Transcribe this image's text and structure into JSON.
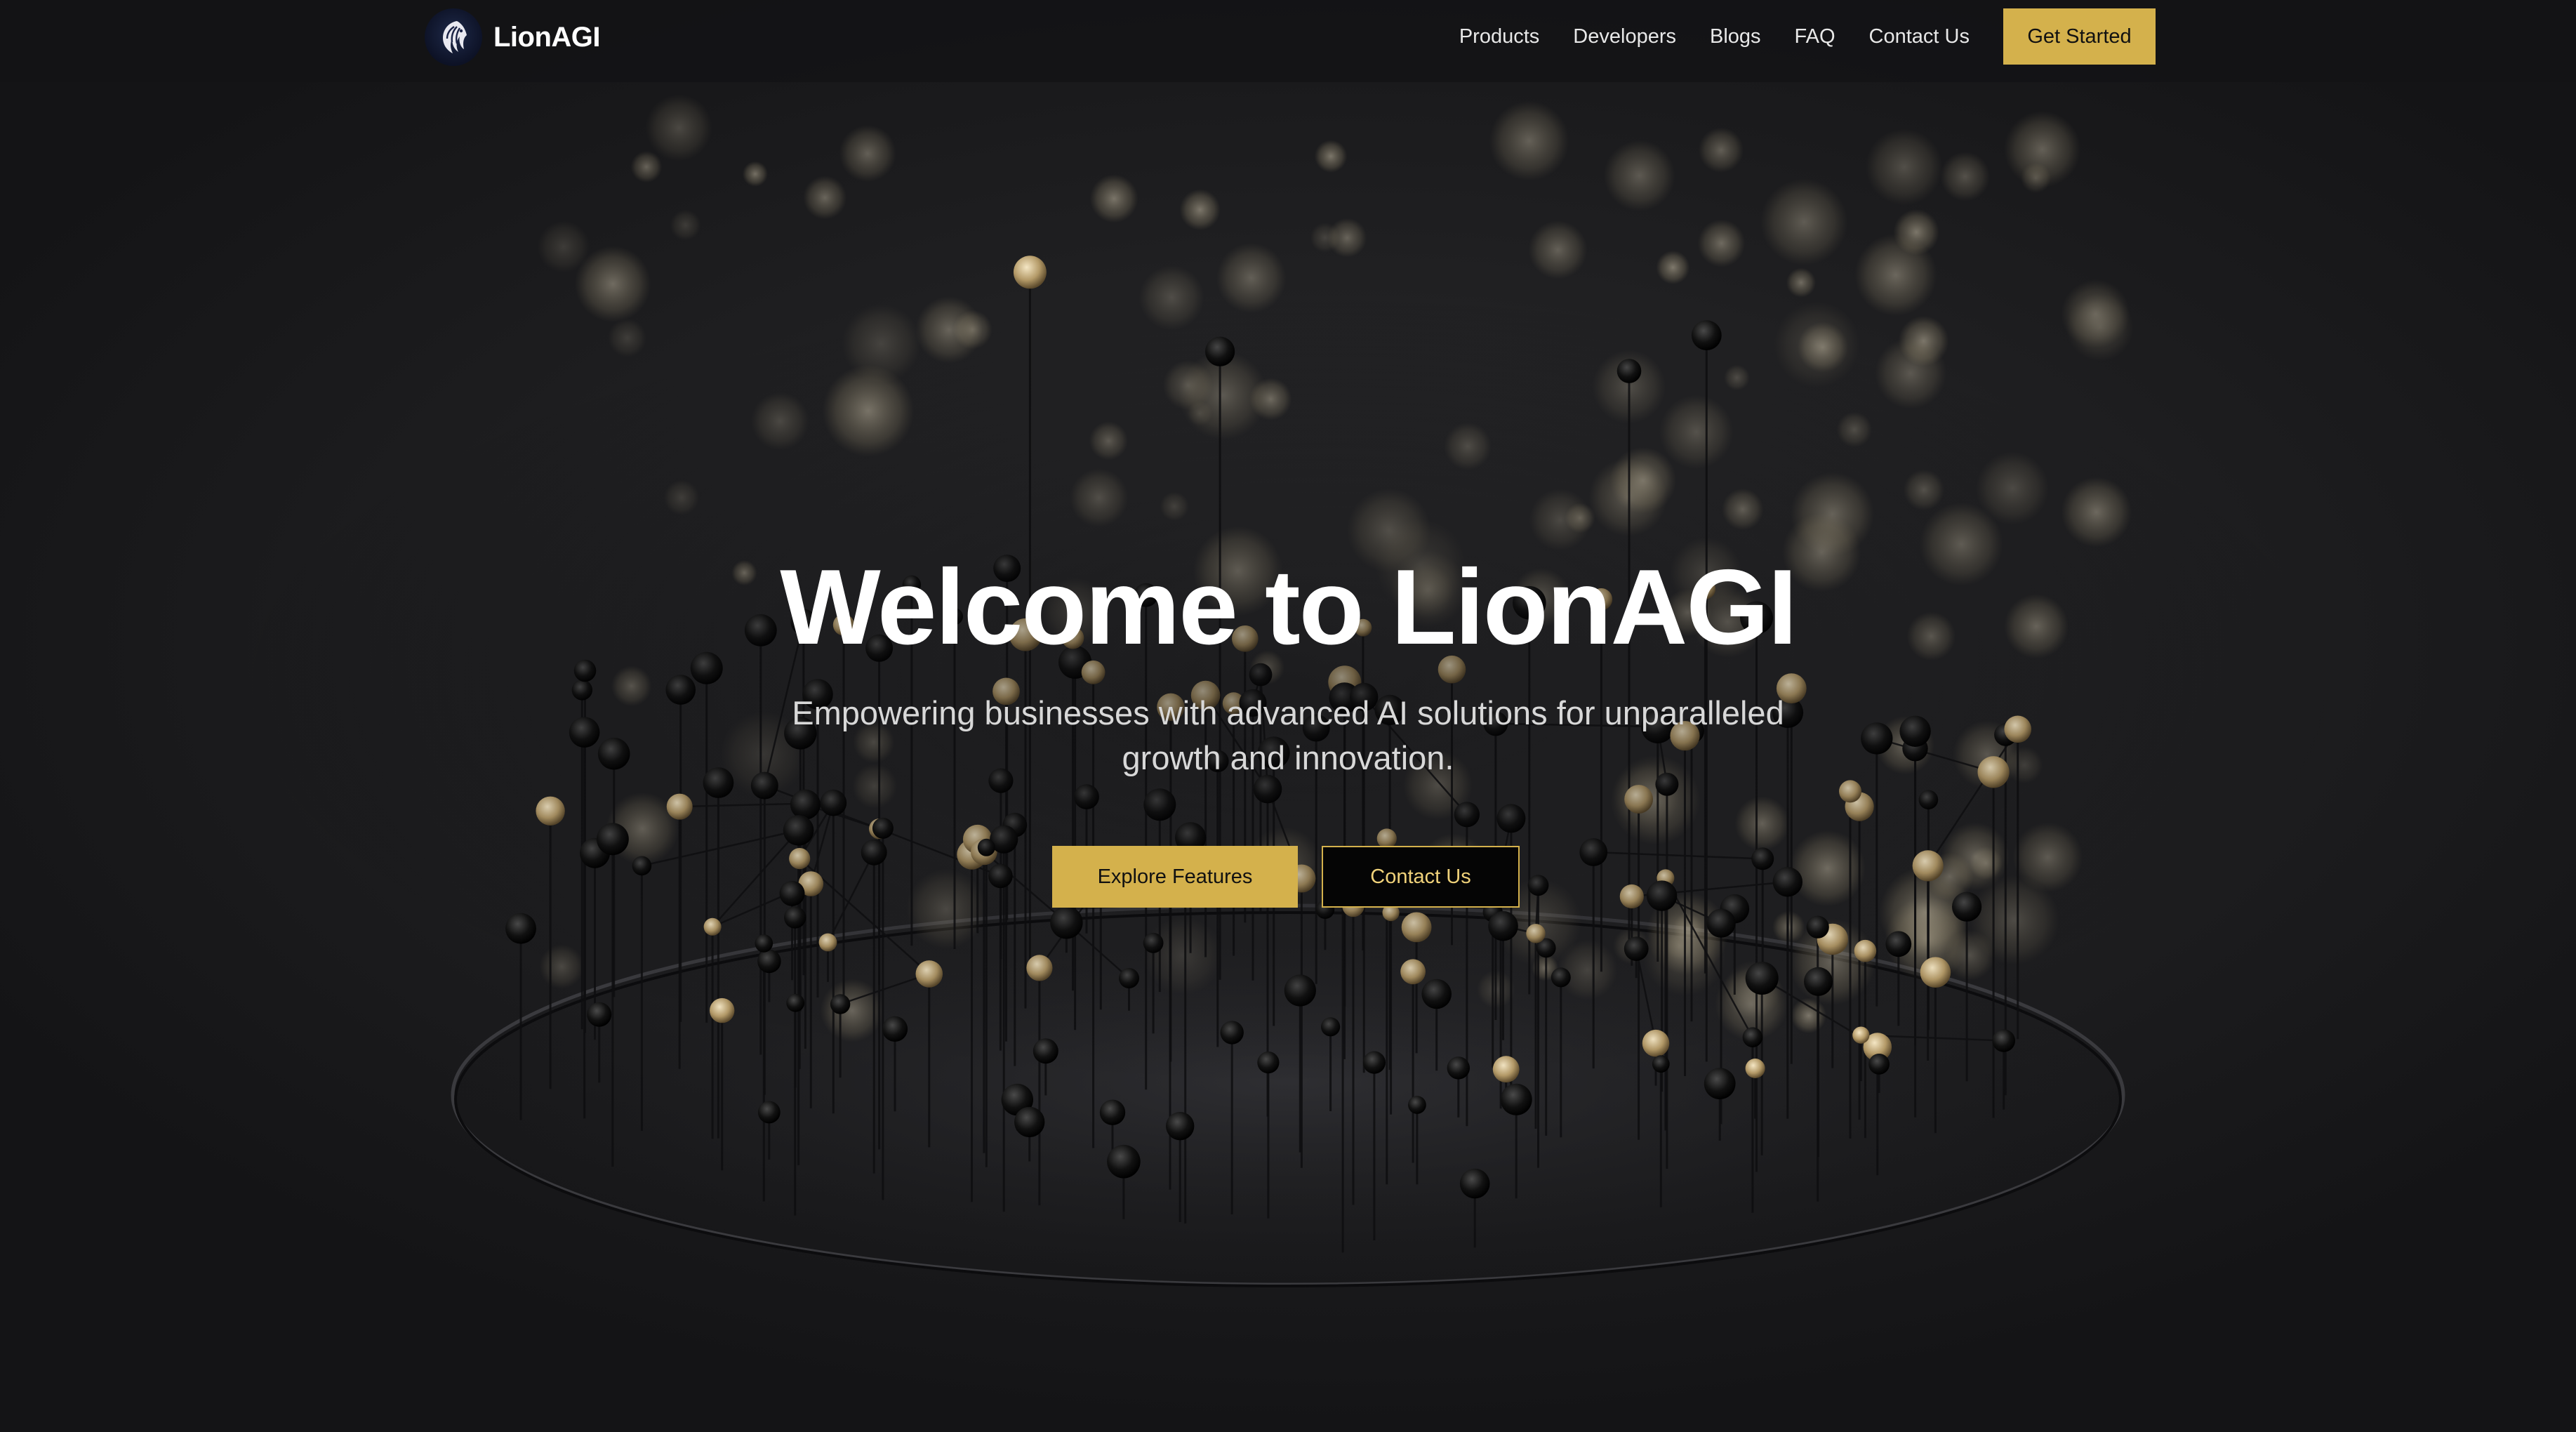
{
  "brand": {
    "name": "LionAGI",
    "logo_icon": "lion-head-icon"
  },
  "nav": {
    "items": [
      {
        "label": "Products"
      },
      {
        "label": "Developers"
      },
      {
        "label": "Blogs"
      },
      {
        "label": "FAQ"
      },
      {
        "label": "Contact Us"
      }
    ],
    "cta_label": "Get Started"
  },
  "hero": {
    "title": "Welcome to LionAGI",
    "subtitle": "Empowering businesses with advanced AI solutions for unparalleled growth and innovation.",
    "primary_button": "Explore Features",
    "secondary_button": "Contact Us"
  },
  "colors": {
    "accent": "#d4b14c",
    "background": "#1a1a1c",
    "navbar": "#141416",
    "text": "#ffffff"
  },
  "background_image": "network-graph-nodes-on-disc"
}
